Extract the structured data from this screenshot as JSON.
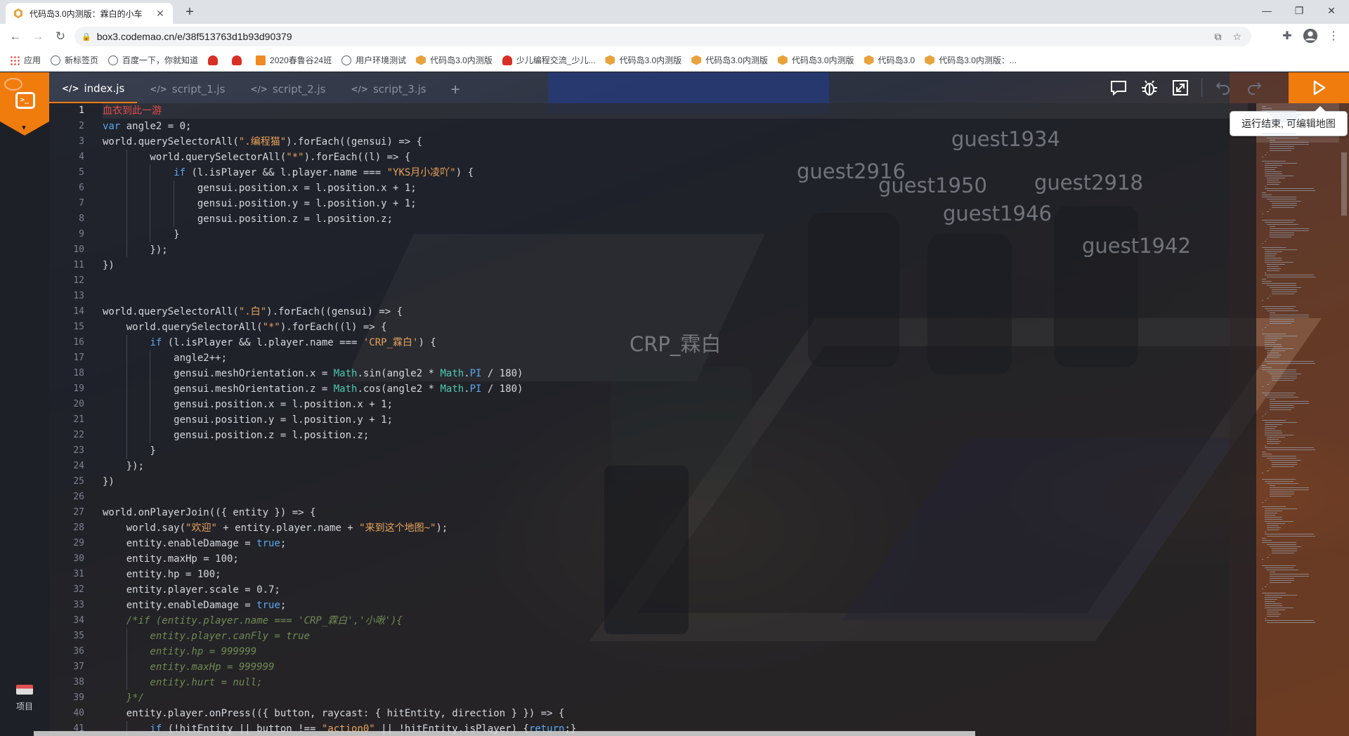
{
  "browser": {
    "tab_title": "代码岛3.0内测版：霖白的小车",
    "tab_close": "✕",
    "new_tab": "+",
    "url": "box3.codemao.cn/e/38f513763d1b93d90379",
    "window_controls": [
      "—",
      "❐",
      "✕"
    ],
    "bookmarks": [
      {
        "label": "应用",
        "icon": "apps-grid-icon"
      },
      {
        "label": "新标签页",
        "icon": "globe-icon"
      },
      {
        "label": "百度一下，你就知道",
        "icon": "globe-icon"
      },
      {
        "label": "",
        "icon": "red-hat-icon"
      },
      {
        "label": "",
        "icon": "red-hat-icon"
      },
      {
        "label": "2020春鲁谷24班",
        "icon": "orange-square-icon"
      },
      {
        "label": "用户环境测试",
        "icon": "globe-icon"
      },
      {
        "label": "代码岛3.0内测版",
        "icon": "hexagon-icon"
      },
      {
        "label": "少儿编程交流_少儿...",
        "icon": "red-hat-icon"
      },
      {
        "label": "代码岛3.0内测版",
        "icon": "hexagon-icon"
      },
      {
        "label": "代码岛3.0内测版",
        "icon": "hexagon-icon"
      },
      {
        "label": "代码岛3.0内测版",
        "icon": "hexagon-icon"
      },
      {
        "label": "代码岛3.0",
        "icon": "hexagon-icon"
      },
      {
        "label": "代码岛3.0内测版：...",
        "icon": "hexagon-icon"
      }
    ]
  },
  "editor": {
    "tabs": [
      {
        "label": "index.js",
        "active": true
      },
      {
        "label": "script_1.js",
        "active": false
      },
      {
        "label": "script_2.js",
        "active": false
      },
      {
        "label": "script_3.js",
        "active": false
      }
    ],
    "add_tab": "+",
    "tooltip": "运行结束, 可编辑地图",
    "sidebar_project_label": "项目",
    "current_line": 1,
    "accent_color": "#f07c0e"
  },
  "scene": {
    "player_tags": [
      "guest1934",
      "guest2916",
      "guest1950",
      "guest2918",
      "guest1946",
      "guest1942",
      "CRP_霖白"
    ]
  },
  "code_lines": [
    [
      {
        "t": "血衣到此一游",
        "c": "red"
      }
    ],
    [
      {
        "t": "var",
        "c": "kw"
      },
      {
        "t": " angle2 = 0;",
        "c": "p"
      }
    ],
    [
      {
        "t": "world.querySelectorAll(",
        "c": "p"
      },
      {
        "t": "\".编程猫\"",
        "c": "s"
      },
      {
        "t": ").forEach((gensui) => {",
        "c": "p"
      }
    ],
    [
      {
        "t": "        world.querySelectorAll(",
        "c": "p"
      },
      {
        "t": "\"*\"",
        "c": "s"
      },
      {
        "t": ").forEach((l) => {",
        "c": "p"
      }
    ],
    [
      {
        "t": "            ",
        "c": "p"
      },
      {
        "t": "if",
        "c": "kw"
      },
      {
        "t": " (l.isPlayer && l.player.name === ",
        "c": "p"
      },
      {
        "t": "\"YKS月小凌吖\"",
        "c": "s"
      },
      {
        "t": ") {",
        "c": "p"
      }
    ],
    [
      {
        "t": "                gensui.position.x = l.position.x + 1;",
        "c": "p"
      }
    ],
    [
      {
        "t": "                gensui.position.y = l.position.y + 1;",
        "c": "p"
      }
    ],
    [
      {
        "t": "                gensui.position.z = l.position.z;",
        "c": "p"
      }
    ],
    [
      {
        "t": "            }",
        "c": "p"
      }
    ],
    [
      {
        "t": "        });",
        "c": "p"
      }
    ],
    [
      {
        "t": "})",
        "c": "p"
      }
    ],
    [],
    [],
    [
      {
        "t": "world.querySelectorAll(",
        "c": "p"
      },
      {
        "t": "\".白\"",
        "c": "s"
      },
      {
        "t": ").forEach((gensui) => {",
        "c": "p"
      }
    ],
    [
      {
        "t": "    world.querySelectorAll(",
        "c": "p"
      },
      {
        "t": "\"*\"",
        "c": "s"
      },
      {
        "t": ").forEach((l) => {",
        "c": "p"
      }
    ],
    [
      {
        "t": "        ",
        "c": "p"
      },
      {
        "t": "if",
        "c": "kw"
      },
      {
        "t": " (l.isPlayer && l.player.name === ",
        "c": "p"
      },
      {
        "t": "'CRP_霖白'",
        "c": "s"
      },
      {
        "t": ") {",
        "c": "p"
      }
    ],
    [
      {
        "t": "            angle2++;",
        "c": "p"
      }
    ],
    [
      {
        "t": "            gensui.meshOrientation.x = ",
        "c": "p"
      },
      {
        "t": "Math",
        "c": "ty"
      },
      {
        "t": ".sin(angle2 * ",
        "c": "p"
      },
      {
        "t": "Math",
        "c": "ty"
      },
      {
        "t": ".",
        "c": "p"
      },
      {
        "t": "PI",
        "c": "kw"
      },
      {
        "t": " / 180)",
        "c": "p"
      }
    ],
    [
      {
        "t": "            gensui.meshOrientation.z = ",
        "c": "p"
      },
      {
        "t": "Math",
        "c": "ty"
      },
      {
        "t": ".cos(angle2 * ",
        "c": "p"
      },
      {
        "t": "Math",
        "c": "ty"
      },
      {
        "t": ".",
        "c": "p"
      },
      {
        "t": "PI",
        "c": "kw"
      },
      {
        "t": " / 180)",
        "c": "p"
      }
    ],
    [
      {
        "t": "            gensui.position.x = l.position.x + 1;",
        "c": "p"
      }
    ],
    [
      {
        "t": "            gensui.position.y = l.position.y + 1;",
        "c": "p"
      }
    ],
    [
      {
        "t": "            gensui.position.z = l.position.z;",
        "c": "p"
      }
    ],
    [
      {
        "t": "        }",
        "c": "p"
      }
    ],
    [
      {
        "t": "    });",
        "c": "p"
      }
    ],
    [
      {
        "t": "})",
        "c": "p"
      }
    ],
    [],
    [
      {
        "t": "world.onPlayerJoin(({ entity }) => {",
        "c": "p"
      }
    ],
    [
      {
        "t": "    world.say(",
        "c": "p"
      },
      {
        "t": "\"欢迎\"",
        "c": "s"
      },
      {
        "t": " + entity.player.name + ",
        "c": "p"
      },
      {
        "t": "\"来到这个地图~\"",
        "c": "s"
      },
      {
        "t": ");",
        "c": "p"
      }
    ],
    [
      {
        "t": "    entity.enableDamage = ",
        "c": "p"
      },
      {
        "t": "true",
        "c": "kw"
      },
      {
        "t": ";",
        "c": "p"
      }
    ],
    [
      {
        "t": "    entity.maxHp = 100;",
        "c": "p"
      }
    ],
    [
      {
        "t": "    entity.hp = 100;",
        "c": "p"
      }
    ],
    [
      {
        "t": "    entity.player.scale = 0.7;",
        "c": "p"
      }
    ],
    [
      {
        "t": "    entity.enableDamage = ",
        "c": "p"
      },
      {
        "t": "true",
        "c": "kw"
      },
      {
        "t": ";",
        "c": "p"
      }
    ],
    [
      {
        "t": "    /*if (entity.player.name === 'CRP_霖白','小啾'){",
        "c": "cm"
      }
    ],
    [
      {
        "t": "        entity.player.canFly = true",
        "c": "cm"
      }
    ],
    [
      {
        "t": "        entity.hp = 999999",
        "c": "cm"
      }
    ],
    [
      {
        "t": "        entity.maxHp = 999999",
        "c": "cm"
      }
    ],
    [
      {
        "t": "        entity.hurt = null;",
        "c": "cm"
      }
    ],
    [
      {
        "t": "    }*/",
        "c": "cm"
      }
    ],
    [
      {
        "t": "    entity.player.onPress(({ button, raycast: { hitEntity, direction } }) => {",
        "c": "p"
      }
    ],
    [
      {
        "t": "        ",
        "c": "p"
      },
      {
        "t": "if",
        "c": "kw"
      },
      {
        "t": " (!hitEntity || button !== ",
        "c": "p"
      },
      {
        "t": "\"action0\"",
        "c": "s"
      },
      {
        "t": " || !hitEntity.isPlayer) {",
        "c": "p"
      },
      {
        "t": "return",
        "c": "kw"
      },
      {
        "t": ";}",
        "c": "p"
      }
    ]
  ],
  "syntax_colors": {
    "p": "#d6d8de",
    "kw": "#5aa7f0",
    "s": "#e8a25c",
    "ty": "#4ec9b0",
    "cm": "#6f8a54",
    "red": "#e24a4a"
  }
}
